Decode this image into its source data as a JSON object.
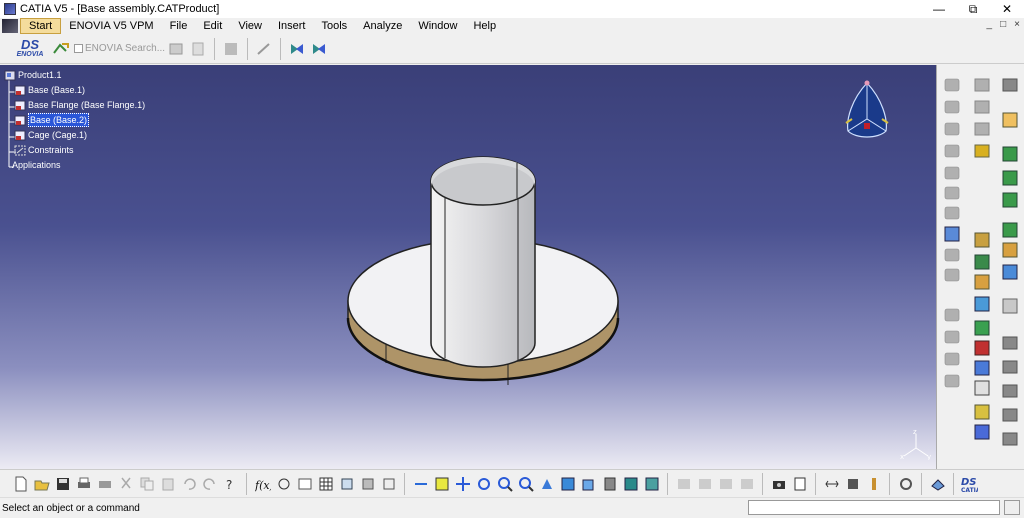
{
  "window": {
    "title": "CATIA V5 - [Base assembly.CATProduct]"
  },
  "menu": {
    "items": [
      {
        "label": "Start"
      },
      {
        "label": "ENOVIA V5 VPM"
      },
      {
        "label": "File"
      },
      {
        "label": "Edit"
      },
      {
        "label": "View"
      },
      {
        "label": "Insert"
      },
      {
        "label": "Tools"
      },
      {
        "label": "Analyze"
      },
      {
        "label": "Window"
      },
      {
        "label": "Help"
      }
    ]
  },
  "toolbar": {
    "enovia_search_label": "ENOVIA Search..."
  },
  "tree": {
    "nodes": [
      {
        "label": "Product1.1"
      },
      {
        "label": "Base (Base.1)"
      },
      {
        "label": "Base Flange (Base Flange.1)"
      },
      {
        "label": "Base (Base.2)"
      },
      {
        "label": "Cage (Cage.1)"
      },
      {
        "label": "Constraints"
      },
      {
        "label": "Applications"
      }
    ]
  },
  "status": {
    "message": "Select an object or a command",
    "command_value": ""
  },
  "colors": {
    "viewport_top": "#3a3f78",
    "viewport_bottom": "#ecebf4",
    "selection": "#2a56d8",
    "accent_gold": "#f4dc9c"
  }
}
